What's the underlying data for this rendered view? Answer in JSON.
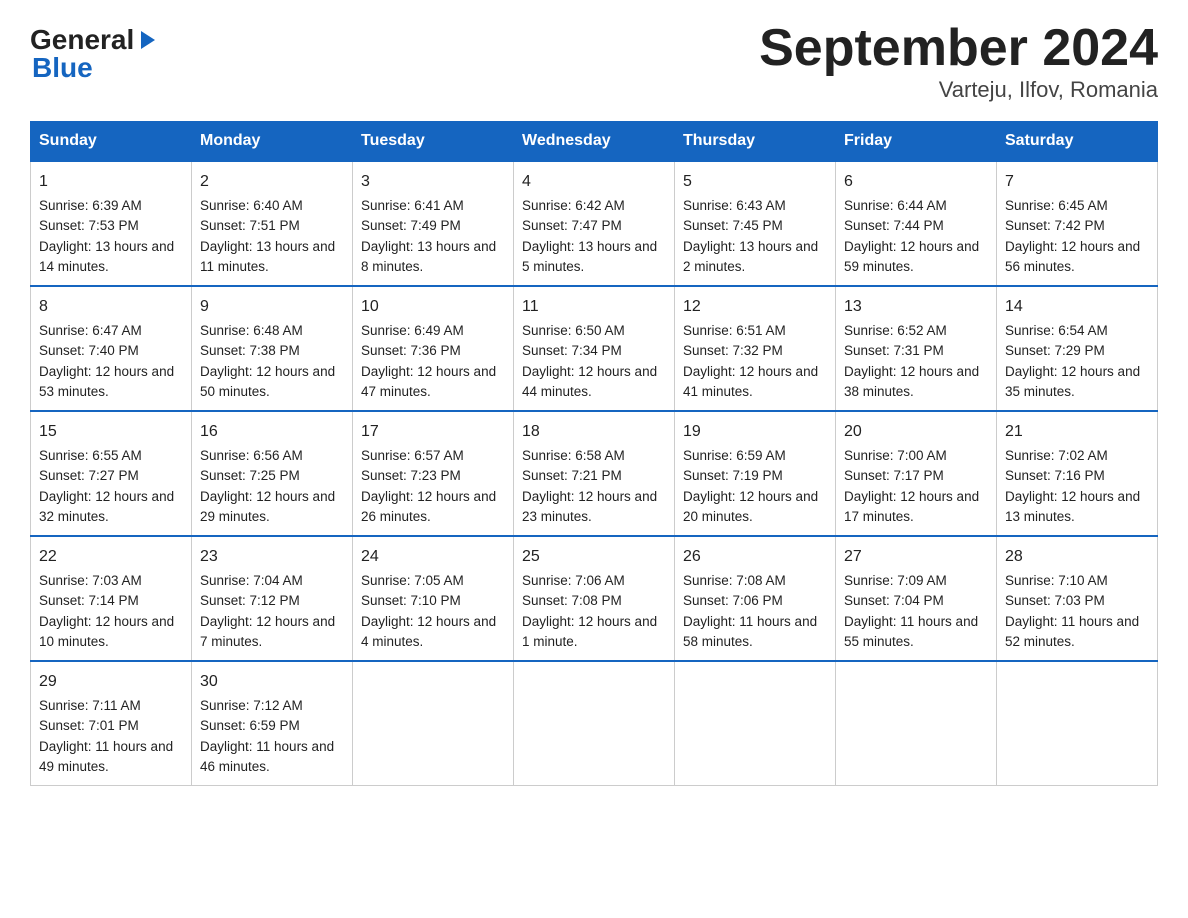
{
  "logo": {
    "general": "General",
    "blue": "Blue"
  },
  "title": "September 2024",
  "subtitle": "Varteju, Ilfov, Romania",
  "weekdays": [
    "Sunday",
    "Monday",
    "Tuesday",
    "Wednesday",
    "Thursday",
    "Friday",
    "Saturday"
  ],
  "weeks": [
    [
      {
        "day": "1",
        "sunrise": "Sunrise: 6:39 AM",
        "sunset": "Sunset: 7:53 PM",
        "daylight": "Daylight: 13 hours and 14 minutes."
      },
      {
        "day": "2",
        "sunrise": "Sunrise: 6:40 AM",
        "sunset": "Sunset: 7:51 PM",
        "daylight": "Daylight: 13 hours and 11 minutes."
      },
      {
        "day": "3",
        "sunrise": "Sunrise: 6:41 AM",
        "sunset": "Sunset: 7:49 PM",
        "daylight": "Daylight: 13 hours and 8 minutes."
      },
      {
        "day": "4",
        "sunrise": "Sunrise: 6:42 AM",
        "sunset": "Sunset: 7:47 PM",
        "daylight": "Daylight: 13 hours and 5 minutes."
      },
      {
        "day": "5",
        "sunrise": "Sunrise: 6:43 AM",
        "sunset": "Sunset: 7:45 PM",
        "daylight": "Daylight: 13 hours and 2 minutes."
      },
      {
        "day": "6",
        "sunrise": "Sunrise: 6:44 AM",
        "sunset": "Sunset: 7:44 PM",
        "daylight": "Daylight: 12 hours and 59 minutes."
      },
      {
        "day": "7",
        "sunrise": "Sunrise: 6:45 AM",
        "sunset": "Sunset: 7:42 PM",
        "daylight": "Daylight: 12 hours and 56 minutes."
      }
    ],
    [
      {
        "day": "8",
        "sunrise": "Sunrise: 6:47 AM",
        "sunset": "Sunset: 7:40 PM",
        "daylight": "Daylight: 12 hours and 53 minutes."
      },
      {
        "day": "9",
        "sunrise": "Sunrise: 6:48 AM",
        "sunset": "Sunset: 7:38 PM",
        "daylight": "Daylight: 12 hours and 50 minutes."
      },
      {
        "day": "10",
        "sunrise": "Sunrise: 6:49 AM",
        "sunset": "Sunset: 7:36 PM",
        "daylight": "Daylight: 12 hours and 47 minutes."
      },
      {
        "day": "11",
        "sunrise": "Sunrise: 6:50 AM",
        "sunset": "Sunset: 7:34 PM",
        "daylight": "Daylight: 12 hours and 44 minutes."
      },
      {
        "day": "12",
        "sunrise": "Sunrise: 6:51 AM",
        "sunset": "Sunset: 7:32 PM",
        "daylight": "Daylight: 12 hours and 41 minutes."
      },
      {
        "day": "13",
        "sunrise": "Sunrise: 6:52 AM",
        "sunset": "Sunset: 7:31 PM",
        "daylight": "Daylight: 12 hours and 38 minutes."
      },
      {
        "day": "14",
        "sunrise": "Sunrise: 6:54 AM",
        "sunset": "Sunset: 7:29 PM",
        "daylight": "Daylight: 12 hours and 35 minutes."
      }
    ],
    [
      {
        "day": "15",
        "sunrise": "Sunrise: 6:55 AM",
        "sunset": "Sunset: 7:27 PM",
        "daylight": "Daylight: 12 hours and 32 minutes."
      },
      {
        "day": "16",
        "sunrise": "Sunrise: 6:56 AM",
        "sunset": "Sunset: 7:25 PM",
        "daylight": "Daylight: 12 hours and 29 minutes."
      },
      {
        "day": "17",
        "sunrise": "Sunrise: 6:57 AM",
        "sunset": "Sunset: 7:23 PM",
        "daylight": "Daylight: 12 hours and 26 minutes."
      },
      {
        "day": "18",
        "sunrise": "Sunrise: 6:58 AM",
        "sunset": "Sunset: 7:21 PM",
        "daylight": "Daylight: 12 hours and 23 minutes."
      },
      {
        "day": "19",
        "sunrise": "Sunrise: 6:59 AM",
        "sunset": "Sunset: 7:19 PM",
        "daylight": "Daylight: 12 hours and 20 minutes."
      },
      {
        "day": "20",
        "sunrise": "Sunrise: 7:00 AM",
        "sunset": "Sunset: 7:17 PM",
        "daylight": "Daylight: 12 hours and 17 minutes."
      },
      {
        "day": "21",
        "sunrise": "Sunrise: 7:02 AM",
        "sunset": "Sunset: 7:16 PM",
        "daylight": "Daylight: 12 hours and 13 minutes."
      }
    ],
    [
      {
        "day": "22",
        "sunrise": "Sunrise: 7:03 AM",
        "sunset": "Sunset: 7:14 PM",
        "daylight": "Daylight: 12 hours and 10 minutes."
      },
      {
        "day": "23",
        "sunrise": "Sunrise: 7:04 AM",
        "sunset": "Sunset: 7:12 PM",
        "daylight": "Daylight: 12 hours and 7 minutes."
      },
      {
        "day": "24",
        "sunrise": "Sunrise: 7:05 AM",
        "sunset": "Sunset: 7:10 PM",
        "daylight": "Daylight: 12 hours and 4 minutes."
      },
      {
        "day": "25",
        "sunrise": "Sunrise: 7:06 AM",
        "sunset": "Sunset: 7:08 PM",
        "daylight": "Daylight: 12 hours and 1 minute."
      },
      {
        "day": "26",
        "sunrise": "Sunrise: 7:08 AM",
        "sunset": "Sunset: 7:06 PM",
        "daylight": "Daylight: 11 hours and 58 minutes."
      },
      {
        "day": "27",
        "sunrise": "Sunrise: 7:09 AM",
        "sunset": "Sunset: 7:04 PM",
        "daylight": "Daylight: 11 hours and 55 minutes."
      },
      {
        "day": "28",
        "sunrise": "Sunrise: 7:10 AM",
        "sunset": "Sunset: 7:03 PM",
        "daylight": "Daylight: 11 hours and 52 minutes."
      }
    ],
    [
      {
        "day": "29",
        "sunrise": "Sunrise: 7:11 AM",
        "sunset": "Sunset: 7:01 PM",
        "daylight": "Daylight: 11 hours and 49 minutes."
      },
      {
        "day": "30",
        "sunrise": "Sunrise: 7:12 AM",
        "sunset": "Sunset: 6:59 PM",
        "daylight": "Daylight: 11 hours and 46 minutes."
      },
      null,
      null,
      null,
      null,
      null
    ]
  ]
}
